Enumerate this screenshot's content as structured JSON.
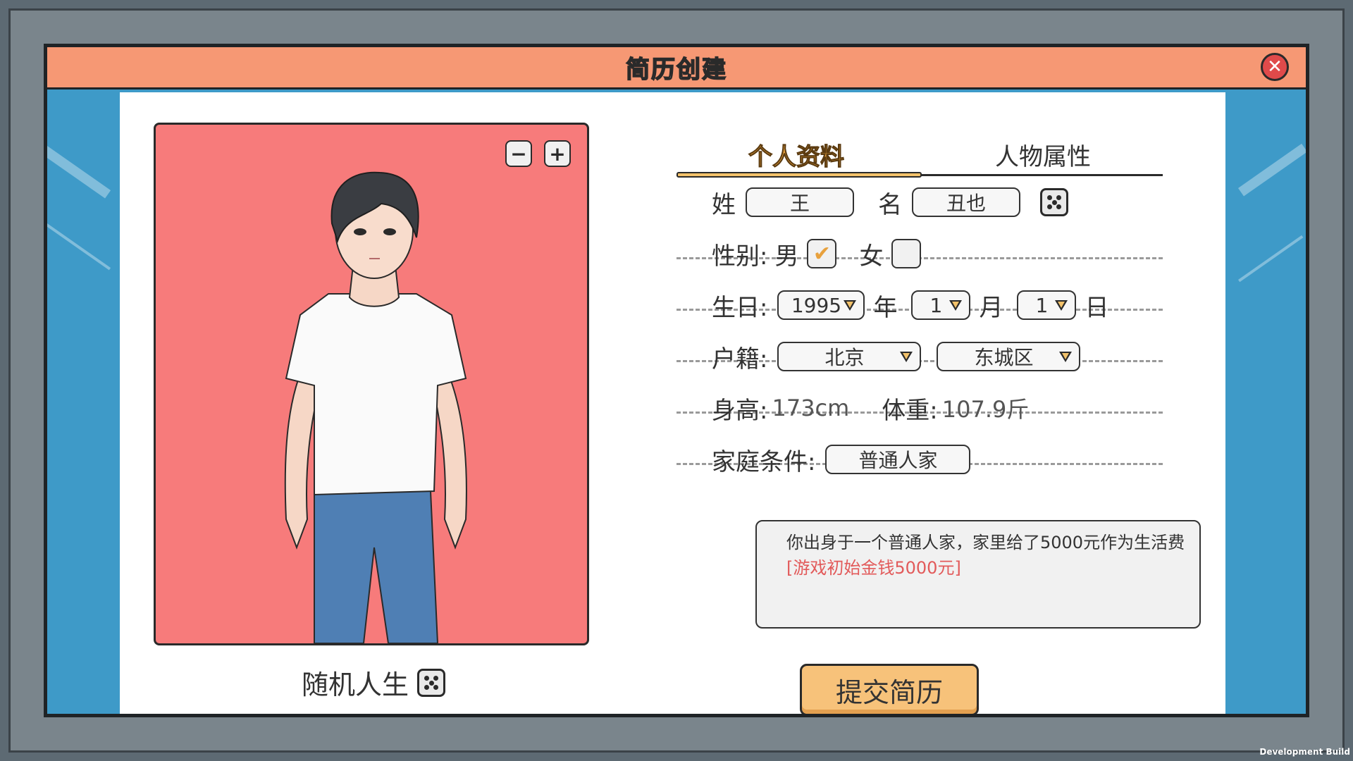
{
  "window": {
    "title": "简历创建",
    "close_icon": "close-icon"
  },
  "portrait": {
    "zoom_out": "−",
    "zoom_in": "+",
    "random_life_label": "随机人生"
  },
  "tabs": [
    {
      "label": "个人资料",
      "active": true
    },
    {
      "label": "人物属性",
      "active": false
    }
  ],
  "profile": {
    "surname_label": "姓",
    "surname": "王",
    "given_name_label": "名",
    "given_name": "丑也",
    "gender_label": "性别:",
    "male_label": "男",
    "male_checked": true,
    "female_label": "女",
    "female_checked": false,
    "birthday_label": "生日:",
    "birth_year": "1995",
    "year_label": "年",
    "birth_month": "1",
    "month_label": "月",
    "birth_day": "1",
    "day_label": "日",
    "hukou_label": "户籍:",
    "province": "北京",
    "district": "东城区",
    "height_label": "身高:",
    "height": "173cm",
    "weight_label": "体重:",
    "weight": "107.9斤",
    "family_label": "家庭条件:",
    "family_value": "普通人家",
    "description": "你出身于一个普通人家，家里给了5000元作为生活费",
    "bonus": "[游戏初始金钱5000元]"
  },
  "submit_label": "提交简历",
  "dev_build_label": "Development Build",
  "colors": {
    "title_bar": "#f69874",
    "accent": "#f3c26a",
    "portrait_bg": "#f77b7b",
    "side": "#3e9ac8"
  }
}
